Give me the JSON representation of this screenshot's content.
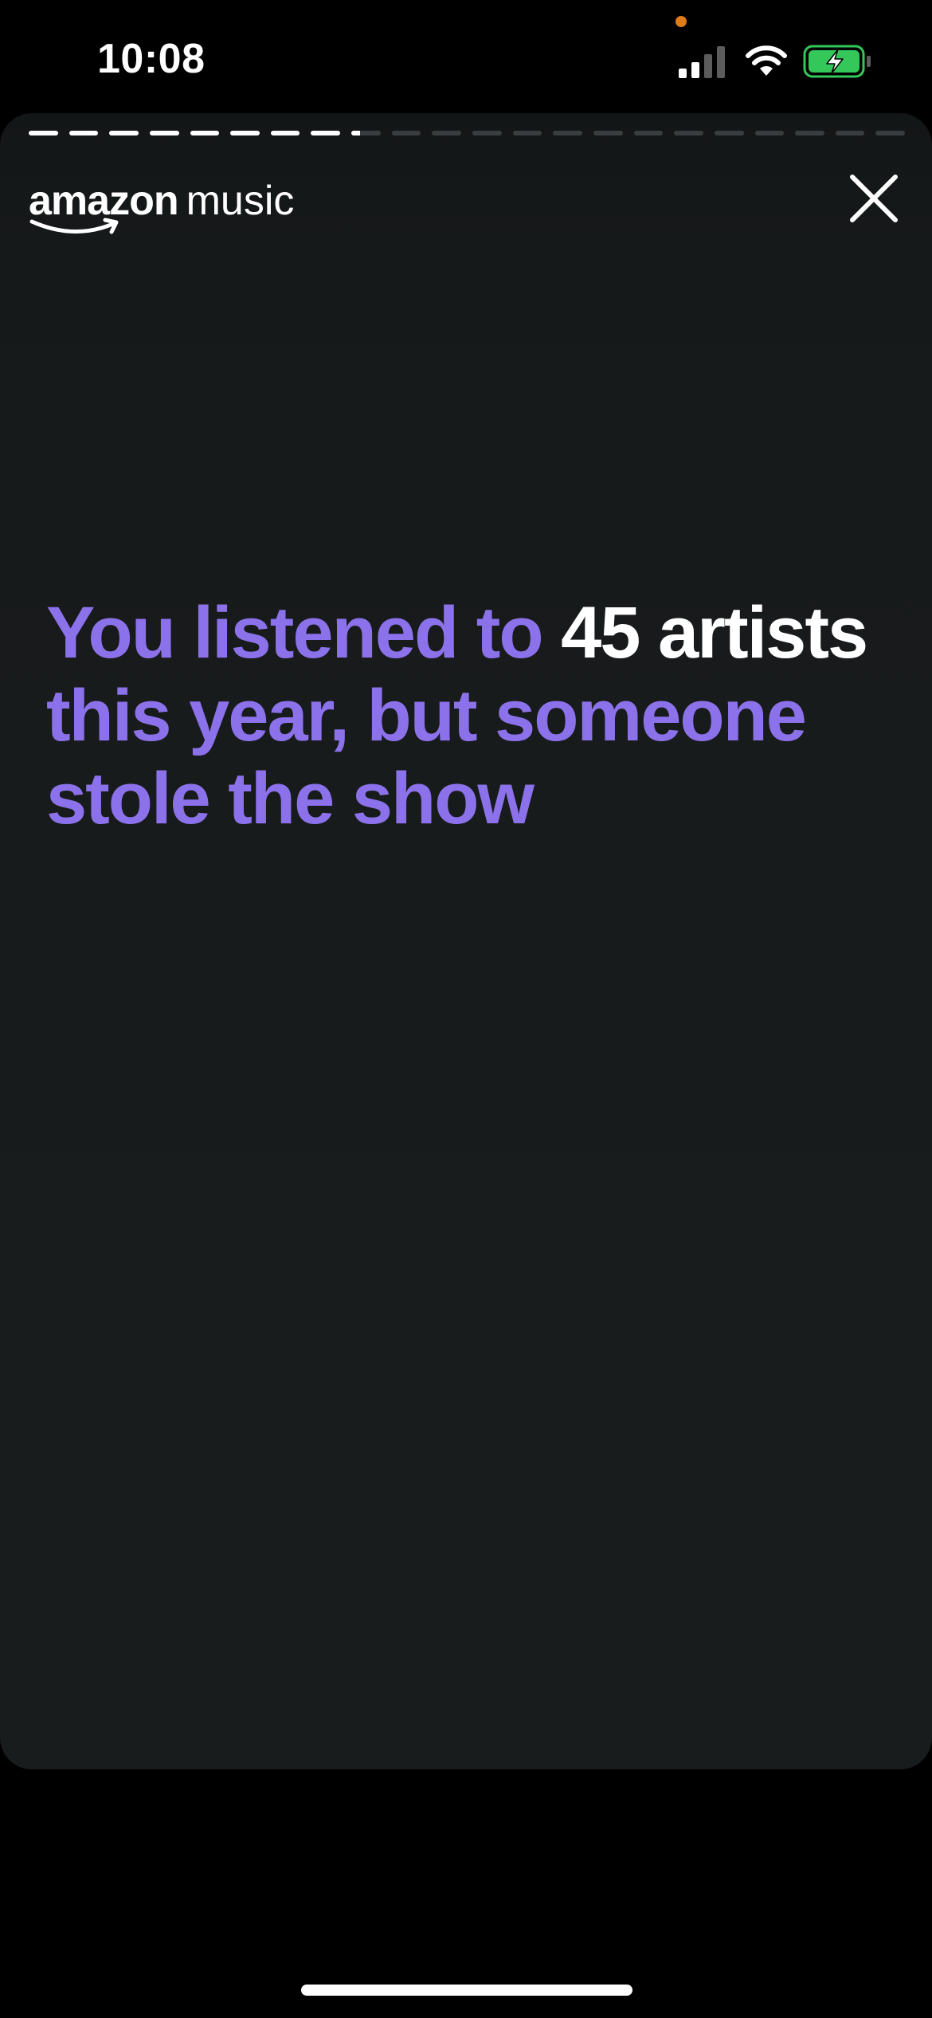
{
  "status_bar": {
    "time": "10:08",
    "privacy_dot_color": "#e07b1a",
    "battery_color": "#34c759",
    "icons": [
      "signal-icon",
      "wifi-icon",
      "battery-charging-icon"
    ]
  },
  "story": {
    "progress": {
      "total_segments": 22,
      "completed_segments": 8,
      "current_segment_fraction": 0.3
    },
    "brand": {
      "word1": "amazon",
      "word2": "music"
    },
    "close_icon": "close-icon",
    "headline": {
      "part1": "You listened to ",
      "highlight": "45 artists",
      "part2": " this year, but someone stole the show"
    },
    "colors": {
      "accent": "#8c72ea",
      "highlight": "#ffffff",
      "card_background": "#181c1d"
    }
  }
}
